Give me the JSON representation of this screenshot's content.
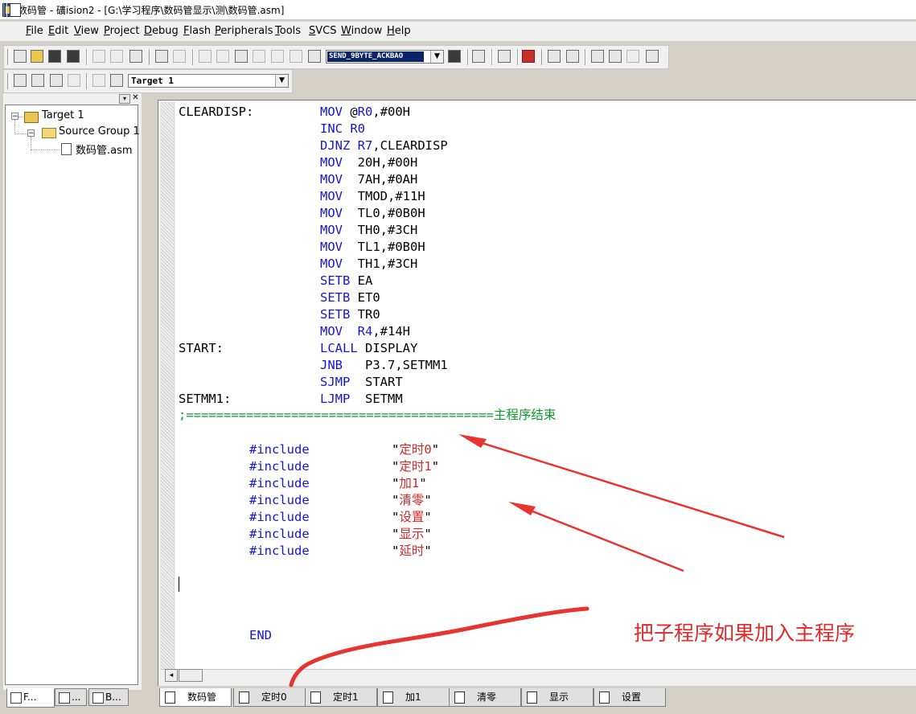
{
  "window": {
    "title": "数码管 - 礦ision2 - [G:\\学习程序\\数码管显示\\测\\数码管.asm]"
  },
  "menubar": {
    "items": [
      "File",
      "Edit",
      "View",
      "Project",
      "Debug",
      "Flash",
      "Peripherals",
      "Tools",
      "SVCS",
      "Window",
      "Help"
    ]
  },
  "toolbar": {
    "function_combo_value": "SEND_9BYTE_ACKBAO",
    "target_combo_value": "Target 1"
  },
  "project_tree": {
    "target": "Target 1",
    "group": "Source Group 1",
    "file": "数码管.asm",
    "panel_tabs": [
      "F...",
      "...",
      "B..."
    ]
  },
  "code": {
    "lines": [
      {
        "label": "CLEARDISP:",
        "op": "MOV",
        "args_pre": " @",
        "args_kw": "R0",
        "args_post": ",#00H"
      },
      {
        "label": "",
        "op": "INC",
        "args_pre": " ",
        "args_kw": "R0",
        "args_post": ""
      },
      {
        "label": "",
        "op": "DJNZ",
        "args_pre": " ",
        "args_kw": "R7",
        "args_post": ",CLEARDISP"
      },
      {
        "label": "",
        "op": "MOV",
        "args_pre": "  20H,#00H",
        "args_kw": "",
        "args_post": ""
      },
      {
        "label": "",
        "op": "MOV",
        "args_pre": "  7AH,#0AH",
        "args_kw": "",
        "args_post": ""
      },
      {
        "label": "",
        "op": "MOV",
        "args_pre": "  TMOD,#11H",
        "args_kw": "",
        "args_post": ""
      },
      {
        "label": "",
        "op": "MOV",
        "args_pre": "  TL0,#0B0H",
        "args_kw": "",
        "args_post": ""
      },
      {
        "label": "",
        "op": "MOV",
        "args_pre": "  TH0,#3CH",
        "args_kw": "",
        "args_post": ""
      },
      {
        "label": "",
        "op": "MOV",
        "args_pre": "  TL1,#0B0H",
        "args_kw": "",
        "args_post": ""
      },
      {
        "label": "",
        "op": "MOV",
        "args_pre": "  TH1,#3CH",
        "args_kw": "",
        "args_post": ""
      },
      {
        "label": "",
        "op": "SETB",
        "args_pre": " EA",
        "args_kw": "",
        "args_post": ""
      },
      {
        "label": "",
        "op": "SETB",
        "args_pre": " ET0",
        "args_kw": "",
        "args_post": ""
      },
      {
        "label": "",
        "op": "SETB",
        "args_pre": " TR0",
        "args_kw": "",
        "args_post": ""
      },
      {
        "label": "",
        "op": "MOV",
        "args_pre": "  ",
        "args_kw": "R4",
        "args_post": ",#14H"
      },
      {
        "label": "START:",
        "op": "LCALL",
        "args_pre": " DISPLAY",
        "args_kw": "",
        "args_post": ""
      },
      {
        "label": "",
        "op": "JNB",
        "args_pre": "   P3.7,SETMM1",
        "args_kw": "",
        "args_post": ""
      },
      {
        "label": "",
        "op": "SJMP",
        "args_pre": "  START",
        "args_kw": "",
        "args_post": ""
      },
      {
        "label": "SETMM1:",
        "op": "LJMP",
        "args_pre": "  SETMM",
        "args_kw": "",
        "args_post": ""
      }
    ],
    "separator_comment": ";=========================================主程序结束",
    "includes": [
      {
        "directive": "#include",
        "name": "定时0"
      },
      {
        "directive": "#include",
        "name": "定时1"
      },
      {
        "directive": "#include",
        "name": "加1"
      },
      {
        "directive": "#include",
        "name": "清零"
      },
      {
        "directive": "#include",
        "name": "设置"
      },
      {
        "directive": "#include",
        "name": "显示"
      },
      {
        "directive": "#include",
        "name": "延时"
      }
    ],
    "end": "END"
  },
  "file_tabs": [
    "数码管",
    "定时0",
    "定时1",
    "加1",
    "清零",
    "显示",
    "设置"
  ],
  "annotation": {
    "text": "把子程序如果加入主程序",
    "color": "#e02a2a"
  }
}
